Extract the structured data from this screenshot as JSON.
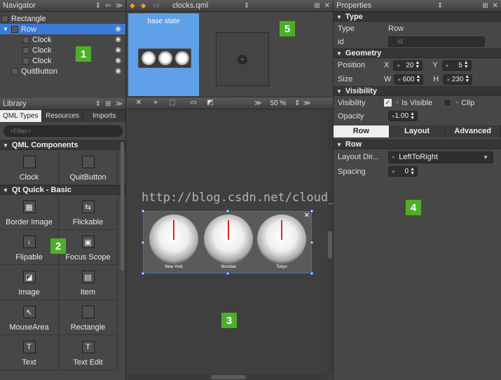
{
  "navigator": {
    "title": "Navigator",
    "items": [
      {
        "label": "Rectangle"
      },
      {
        "label": "Row"
      },
      {
        "label": "Clock"
      },
      {
        "label": "Clock"
      },
      {
        "label": "Clock"
      },
      {
        "label": "QuitButton"
      }
    ]
  },
  "library": {
    "title": "Library",
    "tabs": [
      "QML Types",
      "Resources",
      "Imports"
    ],
    "filter_placeholder": "<Filter>",
    "sections": [
      {
        "title": "QML Components",
        "items": [
          "Clock",
          "QuitButton"
        ]
      },
      {
        "title": "Qt Quick - Basic",
        "items": [
          "Border Image",
          "Flickable",
          "Flipable",
          "Focus Scope",
          "Image",
          "Item",
          "MouseArea",
          "Rectangle",
          "Text",
          "Text Edit"
        ]
      }
    ]
  },
  "editor": {
    "file_name": "clocks.qml",
    "state_label": "base state",
    "zoom": "50 %",
    "clock_labels": [
      "New York",
      "Mumbai",
      "Tokyo"
    ],
    "watermark": "http://blog.csdn.net/cloud_castle"
  },
  "properties": {
    "title": "Properties",
    "type_section": "Type",
    "type_label": "Type",
    "type_value": "Row",
    "id_label": "id",
    "id_placeholder": "id",
    "geometry_section": "Geometry",
    "position_label": "Position",
    "x_label": "X",
    "x_value": "20",
    "y_label": "Y",
    "y_value": "5",
    "size_label": "Size",
    "w_label": "W",
    "w_value": "600",
    "h_label": "H",
    "h_value": "230",
    "visibility_section": "Visibility",
    "visibility_label": "Visibility",
    "is_visible_label": "Is Visible",
    "clip_label": "Clip",
    "opacity_label": "Opacity",
    "opacity_value": "1.00",
    "tabs": [
      "Row",
      "Layout",
      "Advanced"
    ],
    "row_section": "Row",
    "layout_dir_label": "Layout Dir...",
    "layout_dir_value": "LeftToRight",
    "spacing_label": "Spacing",
    "spacing_value": "0"
  },
  "badges": [
    "1",
    "2",
    "3",
    "4",
    "5"
  ]
}
